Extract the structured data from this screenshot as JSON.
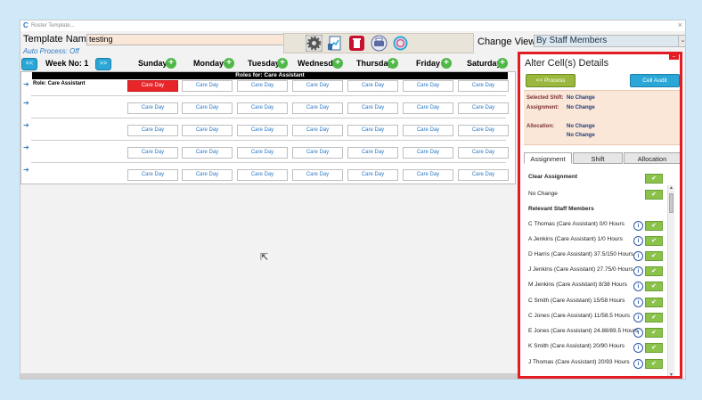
{
  "window": {
    "title": "Roster Template...",
    "close": "×",
    "logo": "C"
  },
  "template": {
    "label": "Template Name:",
    "value": "testing",
    "auto_process": "Auto Process: Off"
  },
  "toolbar": {
    "icons": [
      "gear-icon",
      "document-chart-icon",
      "delete-icon",
      "print-icon",
      "refresh-icon"
    ]
  },
  "change_view": {
    "label": "Change View:",
    "selected": "By Staff Members",
    "arrow": "⌄"
  },
  "week": {
    "prev": "<<",
    "label": "Week No: 1",
    "next": ">>"
  },
  "days": [
    "Sunday",
    "Monday",
    "Tuesday",
    "Wednesda",
    "Thursday",
    "Friday",
    "Saturday"
  ],
  "roles_title": "Roles for: Care Assistant",
  "rows": [
    {
      "role": "Role: Care Assistant",
      "cells": [
        "Care Day",
        "Care Day",
        "Care Day",
        "Care Day",
        "Care Day",
        "Care Day",
        "Care Day"
      ]
    },
    {
      "role": "",
      "cells": [
        "Care Day",
        "Care Day",
        "Care Day",
        "Care Day",
        "Care Day",
        "Care Day",
        "Care Day"
      ]
    },
    {
      "role": "",
      "cells": [
        "Care Day",
        "Care Day",
        "Care Day",
        "Care Day",
        "Care Day",
        "Care Day",
        "Care Day"
      ]
    },
    {
      "role": "",
      "cells": [
        "Care Day",
        "Care Day",
        "Care Day",
        "Care Day",
        "Care Day",
        "Care Day",
        "Care Day"
      ]
    },
    {
      "role": "",
      "cells": [
        "Care Day",
        "Care Day",
        "Care Day",
        "Care Day",
        "Care Day",
        "Care Day",
        "Care Day"
      ]
    }
  ],
  "panel": {
    "title": "Alter Cell(s) Details",
    "process_button": "<< Process",
    "audit_button": "Cell Audit",
    "info": {
      "selected_shift_label": "Selected Shift:",
      "selected_shift_value": "No Change",
      "assignment_label": "Assignment:",
      "assignment_value": "No Change",
      "allocation_label": "Allocation:",
      "allocation_value_1": "No Change",
      "allocation_value_2": "No Change"
    },
    "tabs": [
      "Assignment",
      "Shift",
      "Allocation"
    ],
    "clear_assignment": "Clear Assignment",
    "no_change": "No Change",
    "relevant_heading": "Relevant Staff Members",
    "staff": [
      "C Thomas (Care Assistant) 0/0 Hours",
      "A Jenkins (Care Assistant) 1/0 Hours",
      "D Harris (Care Assistant) 37.5/150 Hours",
      "J Jenkins (Care Assistant) 27.75/0 Hours",
      "M Jenkins (Care Assistant) 8/38 Hours",
      "C Smith (Care Assistant) 15/58 Hours",
      "C Jones (Care Assistant) 11/58.5 Hours",
      "E Jones (Care Assistant) 24.88/89.5 Hours",
      "K Smith (Care Assistant) 20/90 Hours",
      "J Thomas (Care Assistant) 20/93 Hours"
    ],
    "check_glyph": "✔",
    "info_glyph": "i",
    "close_glyph": "–"
  }
}
